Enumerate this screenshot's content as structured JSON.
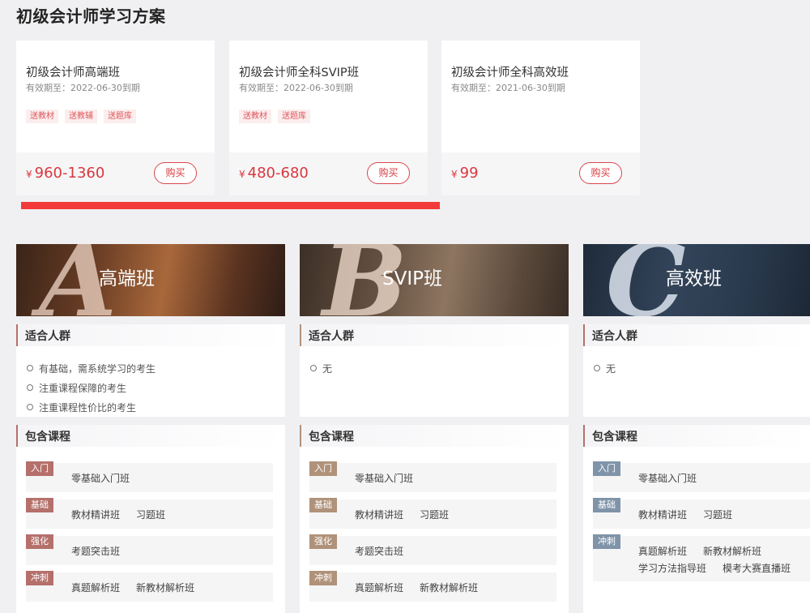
{
  "page_title": "初级会计师学习方案",
  "price_cards": [
    {
      "name": "初级会计师高端班",
      "valid": "有效期至：2022-06-30到期",
      "tags": [
        "送教材",
        "送教辅",
        "送题库"
      ],
      "currency": "¥",
      "price": "960-1360",
      "buy": "购买"
    },
    {
      "name": "初级会计师全科SVIP班",
      "valid": "有效期至：2022-06-30到期",
      "tags": [
        "送教材",
        "送题库"
      ],
      "currency": "¥",
      "price": "480-680",
      "buy": "购买"
    },
    {
      "name": "初级会计师全科高效班",
      "valid": "有效期至：2021-06-30到期",
      "tags": [],
      "currency": "¥",
      "price": "99",
      "buy": "购买"
    }
  ],
  "columns": [
    {
      "letter": "A",
      "title": "高端班",
      "accent": "#b5706c",
      "audience_label": "适合人群",
      "audience": [
        "有基础，需系统学习的考生",
        "注重课程保障的考生",
        "注重课程性价比的考生"
      ],
      "courses_label": "包含课程",
      "courses": [
        {
          "level": "入门",
          "items": [
            "零基础入门班"
          ]
        },
        {
          "level": "基础",
          "items": [
            "教材精讲班",
            "习题班"
          ]
        },
        {
          "level": "强化",
          "items": [
            "考题突击班"
          ]
        },
        {
          "level": "冲刺",
          "items": [
            "真题解析班",
            "新教材解析班"
          ]
        }
      ]
    },
    {
      "letter": "B",
      "title": "SVIP班",
      "accent": "#b0927a",
      "audience_label": "适合人群",
      "audience": [
        "无"
      ],
      "courses_label": "包含课程",
      "courses": [
        {
          "level": "入门",
          "items": [
            "零基础入门班"
          ]
        },
        {
          "level": "基础",
          "items": [
            "教材精讲班",
            "习题班"
          ]
        },
        {
          "level": "强化",
          "items": [
            "考题突击班"
          ]
        },
        {
          "level": "冲刺",
          "items": [
            "真题解析班",
            "新教材解析班"
          ]
        }
      ]
    },
    {
      "letter": "C",
      "title": "高效班",
      "accent": "#7f94a8",
      "audience_label": "适合人群",
      "audience": [
        "无"
      ],
      "courses_label": "包含课程",
      "courses": [
        {
          "level": "入门",
          "items": [
            "零基础入门班"
          ]
        },
        {
          "level": "基础",
          "items": [
            "教材精讲班",
            "习题班"
          ]
        },
        {
          "level": "冲刺",
          "items": [
            "真题解析班",
            "新教材解析班",
            "学习方法指导班",
            "模考大赛直播班"
          ]
        }
      ]
    }
  ]
}
